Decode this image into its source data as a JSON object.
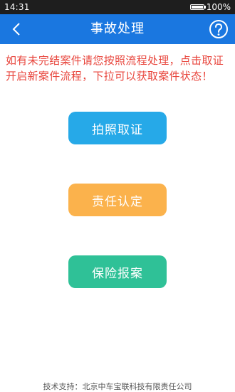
{
  "status_bar": {
    "time": "14:31",
    "battery_text": "100%",
    "battery_level": 1.0
  },
  "nav": {
    "back_icon": "chevron-left-icon",
    "title": "事故处理",
    "help_icon": "question-circle-icon"
  },
  "notice": {
    "text": "如有未完结案件请您按照流程处理，点击取证开启新案件流程，下拉可以获取案件状态！",
    "color": "#e8453c"
  },
  "actions": {
    "photo_evidence": {
      "label": "拍照取证",
      "color": "#26a9e8"
    },
    "liability": {
      "label": "责任认定",
      "color": "#fbb24c"
    },
    "insurance_report": {
      "label": "保险报案",
      "color": "#2fc197"
    }
  },
  "footer": {
    "text": "技术支持：北京中车宝联科技有限责任公司"
  },
  "colors": {
    "nav_bar": "#1a77e0",
    "status_bar": "#1e1e1e"
  }
}
